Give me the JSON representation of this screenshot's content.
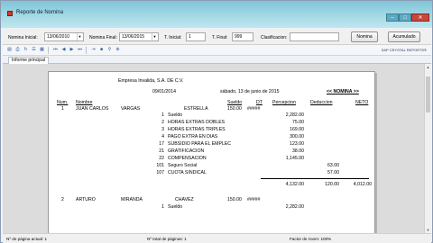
{
  "window": {
    "title": "Reporte de Nomina"
  },
  "filters": {
    "nomina_inicial_label": "Nomina Inicial:",
    "nomina_inicial_value": "13/06/2010",
    "nomina_final_label": "Nomina Final:",
    "nomina_final_value": "13/06/2015",
    "t_inicial_label": "T. Inicial:",
    "t_inicial_value": "1",
    "t_final_label": "T. Final:",
    "t_final_value": "999",
    "clasificacion_label": "Clasificacion:",
    "clasificacion_value": "",
    "nomina_button": "Nomina",
    "acumulado_button": "Acumulado"
  },
  "toolbar": {
    "brand": "SAP CRYSTAL REPORTS®"
  },
  "tabs": [
    {
      "label": "Informe principal"
    }
  ],
  "report": {
    "company": "Empresa Invalida, S.A. DE C.V.",
    "date_left": "09/01/2014",
    "date_right": "sábado, 13 de junio de 2015",
    "title": "<< NOMINA >>",
    "headers": {
      "num": "Num.",
      "nombre": "Nombre",
      "sueldo": "Sueldo",
      "dt": "DT",
      "percepcion": "Percepcion",
      "deduccion": "Deduccion",
      "neto": "NETO"
    },
    "employee1": {
      "num": "1",
      "nombre": "JUAN CARLOS",
      "apellido1": "VARGAS",
      "apellido2": "ESTRELLA",
      "sueldo": "150.00",
      "dt": "#####"
    },
    "lines1": [
      {
        "code": "1",
        "concept": "Sueldo",
        "per": "2,282.00",
        "ded": ""
      },
      {
        "code": "2",
        "concept": "HORAS EXTRAS DOBLES",
        "per": "75.00",
        "ded": ""
      },
      {
        "code": "3",
        "concept": "HORAS EXTRAS TRIPLES",
        "per": "169.00",
        "ded": ""
      },
      {
        "code": "4",
        "concept": "PAGO EXTRA EN DIAS",
        "per": "300.00",
        "ded": ""
      },
      {
        "code": "17",
        "concept": "SUBSIDIO PARA EL EMPLEC",
        "per": "123.00",
        "ded": ""
      },
      {
        "code": "21",
        "concept": "GRATIFICACION",
        "per": "38.00",
        "ded": ""
      },
      {
        "code": "22",
        "concept": "COMPENSACION",
        "per": "1,145.00",
        "ded": ""
      },
      {
        "code": "101",
        "concept": "Seguro Social",
        "per": "",
        "ded": "63.00"
      },
      {
        "code": "107",
        "concept": "CUOTA SINDICAL",
        "per": "",
        "ded": "57.00"
      }
    ],
    "totals1": {
      "per": "4,132.00",
      "ded": "120.00",
      "neto": "4,012.00"
    },
    "employee2": {
      "num": "2",
      "nombre": "ARTURO",
      "apellido1": "MIRANDA",
      "apellido2": "CHAVEZ",
      "sueldo": "150.00",
      "dt": "#####"
    },
    "lines2": [
      {
        "code": "1",
        "concept": "Sueldo",
        "per": "2,282.00",
        "ded": ""
      }
    ]
  },
  "status": {
    "page_current": "Nº de página actual: 1",
    "page_total": "Nº total de páginas: 1",
    "zoom": "Factor de zoom: 100%"
  }
}
